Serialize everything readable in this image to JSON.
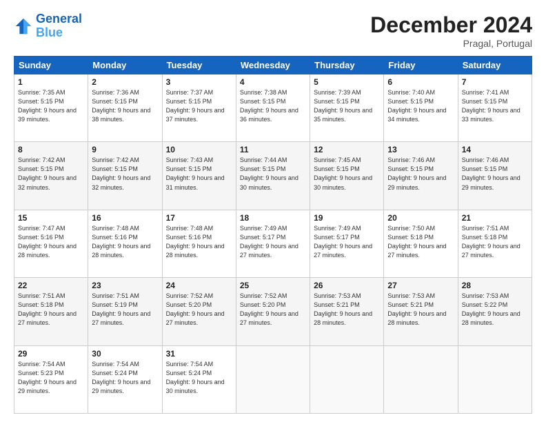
{
  "header": {
    "logo_line1": "General",
    "logo_line2": "Blue",
    "month_title": "December 2024",
    "location": "Pragal, Portugal"
  },
  "days_of_week": [
    "Sunday",
    "Monday",
    "Tuesday",
    "Wednesday",
    "Thursday",
    "Friday",
    "Saturday"
  ],
  "weeks": [
    [
      {
        "day": "1",
        "sunrise": "Sunrise: 7:35 AM",
        "sunset": "Sunset: 5:15 PM",
        "daylight": "Daylight: 9 hours and 39 minutes."
      },
      {
        "day": "2",
        "sunrise": "Sunrise: 7:36 AM",
        "sunset": "Sunset: 5:15 PM",
        "daylight": "Daylight: 9 hours and 38 minutes."
      },
      {
        "day": "3",
        "sunrise": "Sunrise: 7:37 AM",
        "sunset": "Sunset: 5:15 PM",
        "daylight": "Daylight: 9 hours and 37 minutes."
      },
      {
        "day": "4",
        "sunrise": "Sunrise: 7:38 AM",
        "sunset": "Sunset: 5:15 PM",
        "daylight": "Daylight: 9 hours and 36 minutes."
      },
      {
        "day": "5",
        "sunrise": "Sunrise: 7:39 AM",
        "sunset": "Sunset: 5:15 PM",
        "daylight": "Daylight: 9 hours and 35 minutes."
      },
      {
        "day": "6",
        "sunrise": "Sunrise: 7:40 AM",
        "sunset": "Sunset: 5:15 PM",
        "daylight": "Daylight: 9 hours and 34 minutes."
      },
      {
        "day": "7",
        "sunrise": "Sunrise: 7:41 AM",
        "sunset": "Sunset: 5:15 PM",
        "daylight": "Daylight: 9 hours and 33 minutes."
      }
    ],
    [
      {
        "day": "8",
        "sunrise": "Sunrise: 7:42 AM",
        "sunset": "Sunset: 5:15 PM",
        "daylight": "Daylight: 9 hours and 32 minutes."
      },
      {
        "day": "9",
        "sunrise": "Sunrise: 7:42 AM",
        "sunset": "Sunset: 5:15 PM",
        "daylight": "Daylight: 9 hours and 32 minutes."
      },
      {
        "day": "10",
        "sunrise": "Sunrise: 7:43 AM",
        "sunset": "Sunset: 5:15 PM",
        "daylight": "Daylight: 9 hours and 31 minutes."
      },
      {
        "day": "11",
        "sunrise": "Sunrise: 7:44 AM",
        "sunset": "Sunset: 5:15 PM",
        "daylight": "Daylight: 9 hours and 30 minutes."
      },
      {
        "day": "12",
        "sunrise": "Sunrise: 7:45 AM",
        "sunset": "Sunset: 5:15 PM",
        "daylight": "Daylight: 9 hours and 30 minutes."
      },
      {
        "day": "13",
        "sunrise": "Sunrise: 7:46 AM",
        "sunset": "Sunset: 5:15 PM",
        "daylight": "Daylight: 9 hours and 29 minutes."
      },
      {
        "day": "14",
        "sunrise": "Sunrise: 7:46 AM",
        "sunset": "Sunset: 5:15 PM",
        "daylight": "Daylight: 9 hours and 29 minutes."
      }
    ],
    [
      {
        "day": "15",
        "sunrise": "Sunrise: 7:47 AM",
        "sunset": "Sunset: 5:16 PM",
        "daylight": "Daylight: 9 hours and 28 minutes."
      },
      {
        "day": "16",
        "sunrise": "Sunrise: 7:48 AM",
        "sunset": "Sunset: 5:16 PM",
        "daylight": "Daylight: 9 hours and 28 minutes."
      },
      {
        "day": "17",
        "sunrise": "Sunrise: 7:48 AM",
        "sunset": "Sunset: 5:16 PM",
        "daylight": "Daylight: 9 hours and 28 minutes."
      },
      {
        "day": "18",
        "sunrise": "Sunrise: 7:49 AM",
        "sunset": "Sunset: 5:17 PM",
        "daylight": "Daylight: 9 hours and 27 minutes."
      },
      {
        "day": "19",
        "sunrise": "Sunrise: 7:49 AM",
        "sunset": "Sunset: 5:17 PM",
        "daylight": "Daylight: 9 hours and 27 minutes."
      },
      {
        "day": "20",
        "sunrise": "Sunrise: 7:50 AM",
        "sunset": "Sunset: 5:18 PM",
        "daylight": "Daylight: 9 hours and 27 minutes."
      },
      {
        "day": "21",
        "sunrise": "Sunrise: 7:51 AM",
        "sunset": "Sunset: 5:18 PM",
        "daylight": "Daylight: 9 hours and 27 minutes."
      }
    ],
    [
      {
        "day": "22",
        "sunrise": "Sunrise: 7:51 AM",
        "sunset": "Sunset: 5:18 PM",
        "daylight": "Daylight: 9 hours and 27 minutes."
      },
      {
        "day": "23",
        "sunrise": "Sunrise: 7:51 AM",
        "sunset": "Sunset: 5:19 PM",
        "daylight": "Daylight: 9 hours and 27 minutes."
      },
      {
        "day": "24",
        "sunrise": "Sunrise: 7:52 AM",
        "sunset": "Sunset: 5:20 PM",
        "daylight": "Daylight: 9 hours and 27 minutes."
      },
      {
        "day": "25",
        "sunrise": "Sunrise: 7:52 AM",
        "sunset": "Sunset: 5:20 PM",
        "daylight": "Daylight: 9 hours and 27 minutes."
      },
      {
        "day": "26",
        "sunrise": "Sunrise: 7:53 AM",
        "sunset": "Sunset: 5:21 PM",
        "daylight": "Daylight: 9 hours and 28 minutes."
      },
      {
        "day": "27",
        "sunrise": "Sunrise: 7:53 AM",
        "sunset": "Sunset: 5:21 PM",
        "daylight": "Daylight: 9 hours and 28 minutes."
      },
      {
        "day": "28",
        "sunrise": "Sunrise: 7:53 AM",
        "sunset": "Sunset: 5:22 PM",
        "daylight": "Daylight: 9 hours and 28 minutes."
      }
    ],
    [
      {
        "day": "29",
        "sunrise": "Sunrise: 7:54 AM",
        "sunset": "Sunset: 5:23 PM",
        "daylight": "Daylight: 9 hours and 29 minutes."
      },
      {
        "day": "30",
        "sunrise": "Sunrise: 7:54 AM",
        "sunset": "Sunset: 5:24 PM",
        "daylight": "Daylight: 9 hours and 29 minutes."
      },
      {
        "day": "31",
        "sunrise": "Sunrise: 7:54 AM",
        "sunset": "Sunset: 5:24 PM",
        "daylight": "Daylight: 9 hours and 30 minutes."
      },
      null,
      null,
      null,
      null
    ]
  ]
}
